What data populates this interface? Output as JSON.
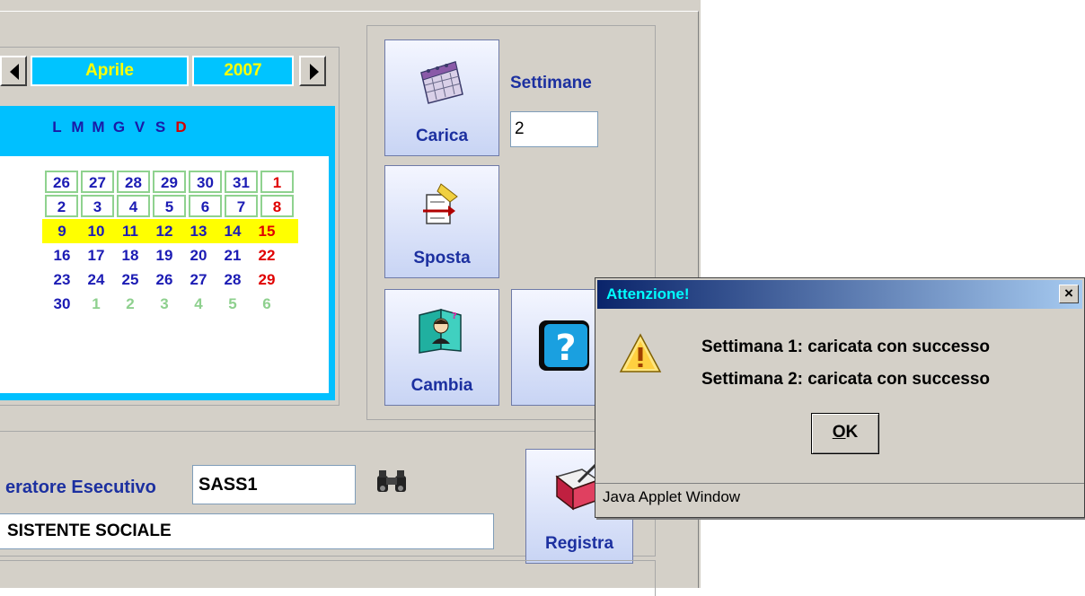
{
  "calendar": {
    "month": "Aprile",
    "year": "2007",
    "weekdays": [
      "L",
      "M",
      "M",
      "G",
      "V",
      "S",
      "D"
    ],
    "weeks": [
      [
        "26",
        "27",
        "28",
        "29",
        "30",
        "31",
        "1"
      ],
      [
        "2",
        "3",
        "4",
        "5",
        "6",
        "7",
        "8"
      ],
      [
        "9",
        "10",
        "11",
        "12",
        "13",
        "14",
        "15"
      ],
      [
        "16",
        "17",
        "18",
        "19",
        "20",
        "21",
        "22"
      ],
      [
        "23",
        "24",
        "25",
        "26",
        "27",
        "28",
        "29"
      ],
      [
        "30",
        "1",
        "2",
        "3",
        "4",
        "5",
        "6"
      ]
    ]
  },
  "actions": {
    "carica": "Carica",
    "sposta": "Sposta",
    "cambia": "Cambia",
    "settimane_label": "Settimane",
    "settimane_value": "2"
  },
  "operator": {
    "label": "eratore Esecutivo",
    "code": "SASS1",
    "description": "SISTENTE SOCIALE",
    "registra": "Registra"
  },
  "dialog": {
    "title": "Attenzione!",
    "close": "×",
    "messages": [
      "Settimana 1: caricata con successo",
      "Settimana 2: caricata con successo"
    ],
    "ok_mnemonic": "O",
    "ok_rest": "K",
    "footer": "Java Applet Window"
  },
  "colors": {
    "calendar_bg": "#00c0ff",
    "current_week": "#ffff00",
    "day_text": "#1c1cb4",
    "sunday_text": "#e00000",
    "dialog_title_start": "#0a246a"
  }
}
